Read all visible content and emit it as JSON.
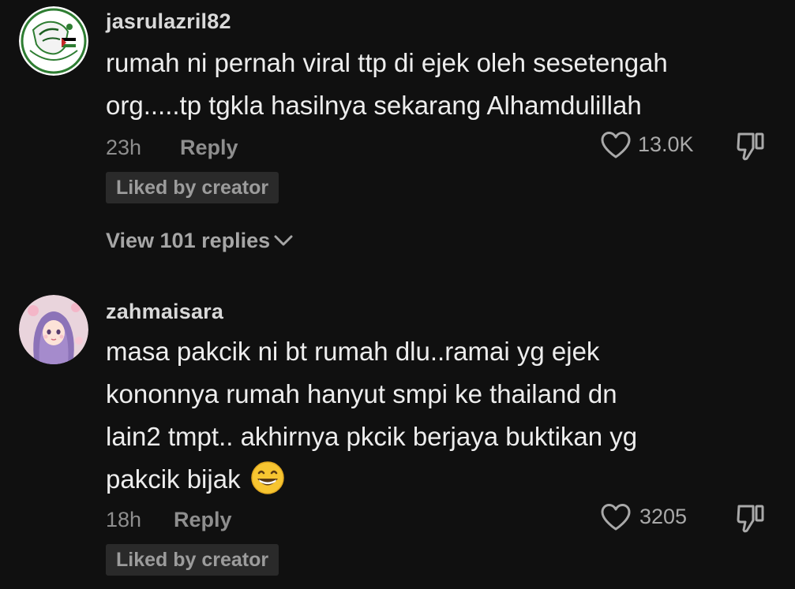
{
  "comments": [
    {
      "username": "jasrulazril82",
      "text_lines": [
        "rumah ni pernah viral ttp di ejek oleh sesetengah",
        "org.....tp tgkla hasilnya sekarang Alhamdulillah"
      ],
      "time": "23h",
      "reply_label": "Reply",
      "likes": "13.0K",
      "liked_badge": "Liked by creator",
      "view_replies": "View 101 replies",
      "avatar_icon": "palestine-emblem-avatar"
    },
    {
      "username": "zahmaisara",
      "text_lines": [
        "masa pakcik ni bt rumah dlu..ramai yg ejek",
        "kononnya rumah hanyut smpi ke thailand dn",
        "lain2 tmpt.. akhirnya pkcik berjaya buktikan yg",
        "pakcik bijak"
      ],
      "emoji": "grinning-face-emoji",
      "time": "18h",
      "reply_label": "Reply",
      "likes": "3205",
      "liked_badge": "Liked by creator",
      "avatar_icon": "hijab-girl-avatar"
    }
  ],
  "colors": {
    "background": "#101010",
    "text_primary": "#ededed",
    "text_muted": "#8e8e8e",
    "badge_bg": "#2a2a2a",
    "emoji_yellow": "#f7c531"
  }
}
